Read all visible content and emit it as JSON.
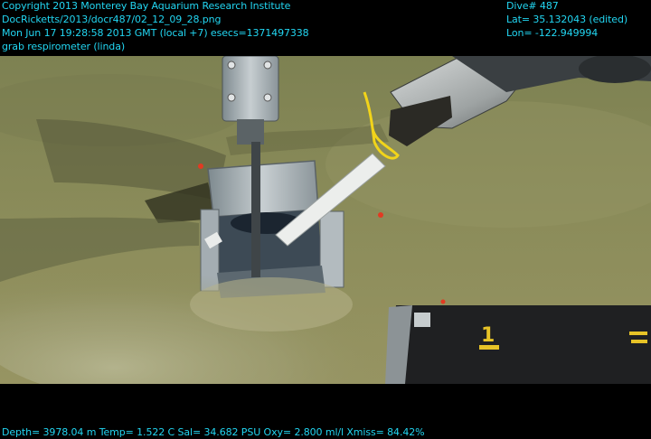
{
  "overlay": {
    "copyright": "Copyright 2013 Monterey Bay Aquarium Research Institute",
    "file_path": "DocRicketts/2013/docr487/02_12_09_28.png",
    "timestamp": "Mon Jun 17 19:28:58 2013 GMT (local +7)  esecs=1371497338",
    "caption": "grab respirometer (linda)",
    "dive": "Dive# 487",
    "latitude": "Lat= 35.132043 (edited)",
    "longitude": "Lon= -122.949994",
    "telemetry": "Depth= 3978.04 m  Temp= 1.522 C  Sal= 34.682 PSU  Oxy= 2.800 ml/l  Xmiss= 84.42%"
  },
  "scene": {
    "box_marking": "1",
    "colors": {
      "hud_text": "#22d6f2",
      "seafloor": "#8a8b58",
      "tether": "#f2d41a"
    }
  }
}
